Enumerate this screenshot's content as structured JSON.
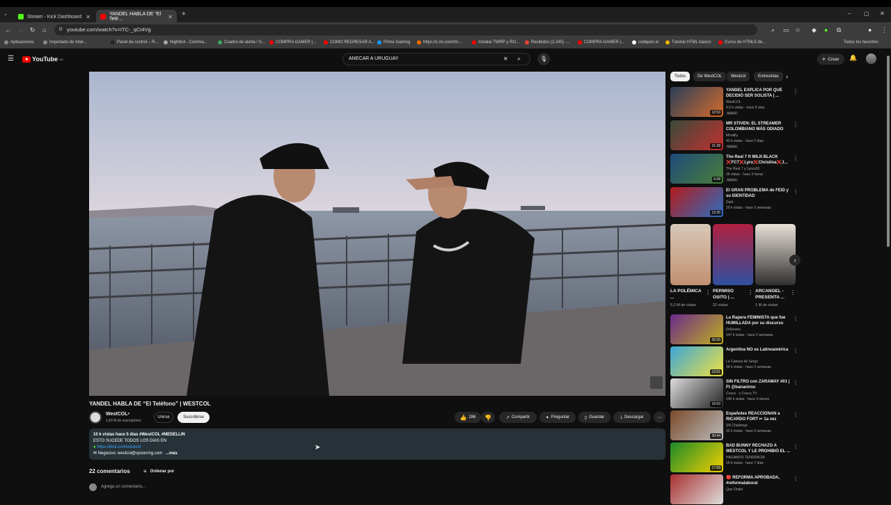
{
  "tabs": [
    {
      "title": "Stream - Kick Dashboard",
      "fav": "#53fc18"
    },
    {
      "title": "YANDEL HABLA DE \"El Telé…",
      "fav": "#ff0000"
    }
  ],
  "address": "youtube.com/watch?v=ITC-_qCt4Vg",
  "bookmarks": [
    {
      "label": "Aplicaciones",
      "color": "#888"
    },
    {
      "label": "Importado de Inter...",
      "color": "#888"
    },
    {
      "label": "Panel de control – R...",
      "color": "#222"
    },
    {
      "label": "Nightbot - Comma...",
      "color": "#aaa"
    },
    {
      "label": "Cuadro de alerta / S...",
      "color": "#3ba55c"
    },
    {
      "label": "COMPRA GAMER |...",
      "color": "#ff0000"
    },
    {
      "label": "COMO REGRESAR A...",
      "color": "#ff0000"
    },
    {
      "label": "Prime Gaming",
      "color": "#1a98ff"
    },
    {
      "label": "https://c.mi.com//m...",
      "color": "#ff6900"
    },
    {
      "label": "Instalar TWRP y RO...",
      "color": "#ff0000"
    },
    {
      "label": "Recibidos (2.245) -...",
      "color": "#ea4335"
    },
    {
      "label": "COMPRA GAMER |...",
      "color": "#ff0000"
    },
    {
      "label": "codepen.io",
      "color": "#fff"
    },
    {
      "label": "Tutorial HTML básico",
      "color": "#f4b400"
    },
    {
      "label": "Curso de HTML5 de...",
      "color": "#ff0000"
    }
  ],
  "bookmarks_all": "Todos los favoritos",
  "yt": {
    "logo": "YouTube",
    "country": "AR",
    "search_value": "ANECAR A URUGUAY",
    "create": "Crear"
  },
  "video": {
    "title": "YANDEL HABLA DE “El Teléfono” | WESTCOL",
    "channel": "WestCOL",
    "subs": "1,83 M de suscriptores",
    "join": "Unirse",
    "subscribe": "Suscribirse",
    "likes": "286",
    "share": "Compartir",
    "ask": "Preguntar",
    "save": "Guardar",
    "download": "Descargar"
  },
  "description": {
    "line1": "10 k vistas  hace 5 días  #WestCOL #MEDELLIN",
    "line2": "ESTO SUCEDE TODOS LOS DIAS EN",
    "link": "https://kick.com/westcol",
    "line4": "Negocios: westcol@spoonrng.com",
    "more": "...más"
  },
  "comments": {
    "count": "22 comentarios",
    "sort": "Ordenar por",
    "placeholder": "Agrega un comentario..."
  },
  "chips": [
    "Todos",
    "De WestCOL",
    "Westcol",
    "Entrevistas"
  ],
  "recs": [
    {
      "title": "YANDEL EXPLICA POR QUÉ DECIDIÓ SER SOLISTA | ...",
      "channel": "WestCOL",
      "meta": "9,9 k vistas · hace 5 días",
      "badge": "Nuevo",
      "dur": "12:53",
      "c1": "#2a3f5a",
      "c2": "#d46a2a"
    },
    {
      "title": "MR STIVEN: EL STREAMER COLOMBIANO MÁS ODIADO",
      "channel": "Mrvallly",
      "meta": "42 k vistas · hace 2 días",
      "badge": "Nuevo",
      "dur": "21:38",
      "c1": "#3a4a3a",
      "c2": "#c23030"
    },
    {
      "title": "The Real 7 ft MILN BLACK ❌FC7❌Lyru❌Christina❌J...",
      "channel": "The Real 7 y Lyrics63",
      "meta": "36 vistas · hace 3 horas",
      "badge": "Nuevo",
      "dur": "6:08",
      "c1": "#1d4a7a",
      "c2": "#4a7f3a"
    },
    {
      "title": "El GRAN PROBLEMA de FEID y su IDENTIDAD",
      "channel": "Dark",
      "meta": "29 k vistas · hace 3 semanas",
      "badge": "",
      "dur": "12:35",
      "c1": "#b51b1b",
      "c2": "#2c6cc0"
    },
    {
      "title": "La Rapera FEMINISTA que fue HUMILLADA por su discurso",
      "channel": "DrSevers",
      "meta": "147 k vistas · hace 2 semanas",
      "badge": "",
      "dur": "35:56",
      "c1": "#6a2a8a",
      "c2": "#c0b020"
    },
    {
      "title": "Argentina NO es Latinoamérica",
      "channel": "La Cabeza de Sergo",
      "meta": "39 k vistas · hace 2 semanas",
      "badge": "",
      "dur": "13:01",
      "c1": "#3aa7d8",
      "c2": "#f0e040"
    },
    {
      "title": "SIN FILTRO con ZARAMAY #01 | Ft @bananirou",
      "channel": "Coscu · y Coscu TV",
      "meta": "146 k vistas · hace 3 meses",
      "badge": "",
      "dur": "16:53",
      "c1": "#ddd",
      "c2": "#222"
    },
    {
      "title": "Españoles REACCIONAN a RICARDO FORT ✂ 1a vez",
      "channel": "SN Challenge",
      "meta": "22 k vistas · hace 3 semanas",
      "badge": "",
      "dur": "30:44",
      "c1": "#7a4a2a",
      "c2": "#bbb"
    },
    {
      "title": "BAD BUNNY RECHAZÓ A WESTCOL Y LE PROHIBIÓ EL ...",
      "channel": "HAGAMOS TENDENCIA",
      "meta": "29 k vistas · hace 7 días",
      "badge": "",
      "dur": "17:08",
      "c1": "#1b8a2a",
      "c2": "#f4d000"
    },
    {
      "title": "🔴 REFORMA APROBADA, #reformalaboral",
      "channel": "Que Onda!",
      "meta": "",
      "badge": "",
      "dur": "",
      "c1": "#aa3030",
      "c2": "#ddd"
    }
  ],
  "shorts": [
    {
      "title": "LA POLÉMICA ...",
      "meta": "5,2 M de vistas",
      "c1": "#d8c8b8",
      "c2": "#c09070"
    },
    {
      "title": "PERMISO OSITO | ...",
      "meta": "22 vistas",
      "c1": "#b02040",
      "c2": "#3050a0"
    },
    {
      "title": "ARCANGEL - PRESENTA ...",
      "meta": "1 M de vistas",
      "c1": "#e8e0d8",
      "c2": "#303030"
    }
  ]
}
